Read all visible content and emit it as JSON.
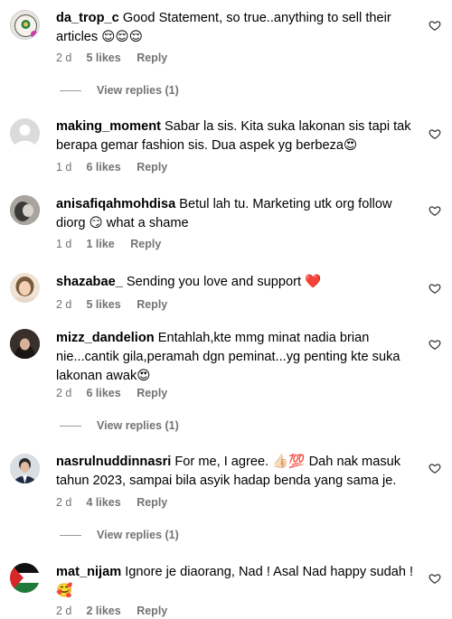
{
  "comments": [
    {
      "username": "da_trop_c",
      "text": "Good Statement, so true..anything to sell their articles 😌😌😌",
      "time": "2 d",
      "likes": "5 likes",
      "reply": "Reply",
      "view_replies": "View replies (1)"
    },
    {
      "username": "making_moment",
      "text": "Sabar la sis. Kita suka lakonan sis tapi tak berapa gemar fashion sis. Dua aspek yg berbeza😍",
      "time": "1 d",
      "likes": "6 likes",
      "reply": "Reply"
    },
    {
      "username": "anisafiqahmohdisa",
      "text": "Betul lah tu. Marketing utk org follow diorg 😏 what a shame",
      "time": "1 d",
      "likes": "1 like",
      "reply": "Reply"
    },
    {
      "username": "shazabae_",
      "text": "Sending you love and support ❤️",
      "time": "2 d",
      "likes": "5 likes",
      "reply": "Reply"
    },
    {
      "username": "mizz_dandelion",
      "text": "Entahlah,kte mmg minat nadia brian nie...cantik gila,peramah dgn peminat...yg penting kte suka lakonan awak😍",
      "time": "2 d",
      "likes": "6 likes",
      "reply": "Reply",
      "view_replies": "View replies (1)"
    },
    {
      "username": "nasrulnuddinnasri",
      "text": "For me, I agree. 👍🏻💯 Dah nak masuk tahun 2023, sampai bila asyik hadap benda yang sama je.",
      "time": "2 d",
      "likes": "4 likes",
      "reply": "Reply",
      "view_replies": "View replies (1)"
    },
    {
      "username": "mat_nijam",
      "text": "Ignore je diaorang, Nad ! Asal Nad happy sudah ! 🥰",
      "time": "2 d",
      "likes": "2 likes",
      "reply": "Reply"
    }
  ],
  "icons": {
    "like": "heart-outline-icon"
  },
  "colors": {
    "meta": "#737373",
    "flag_green": "#1f7a3a",
    "flag_red": "#d62828"
  }
}
